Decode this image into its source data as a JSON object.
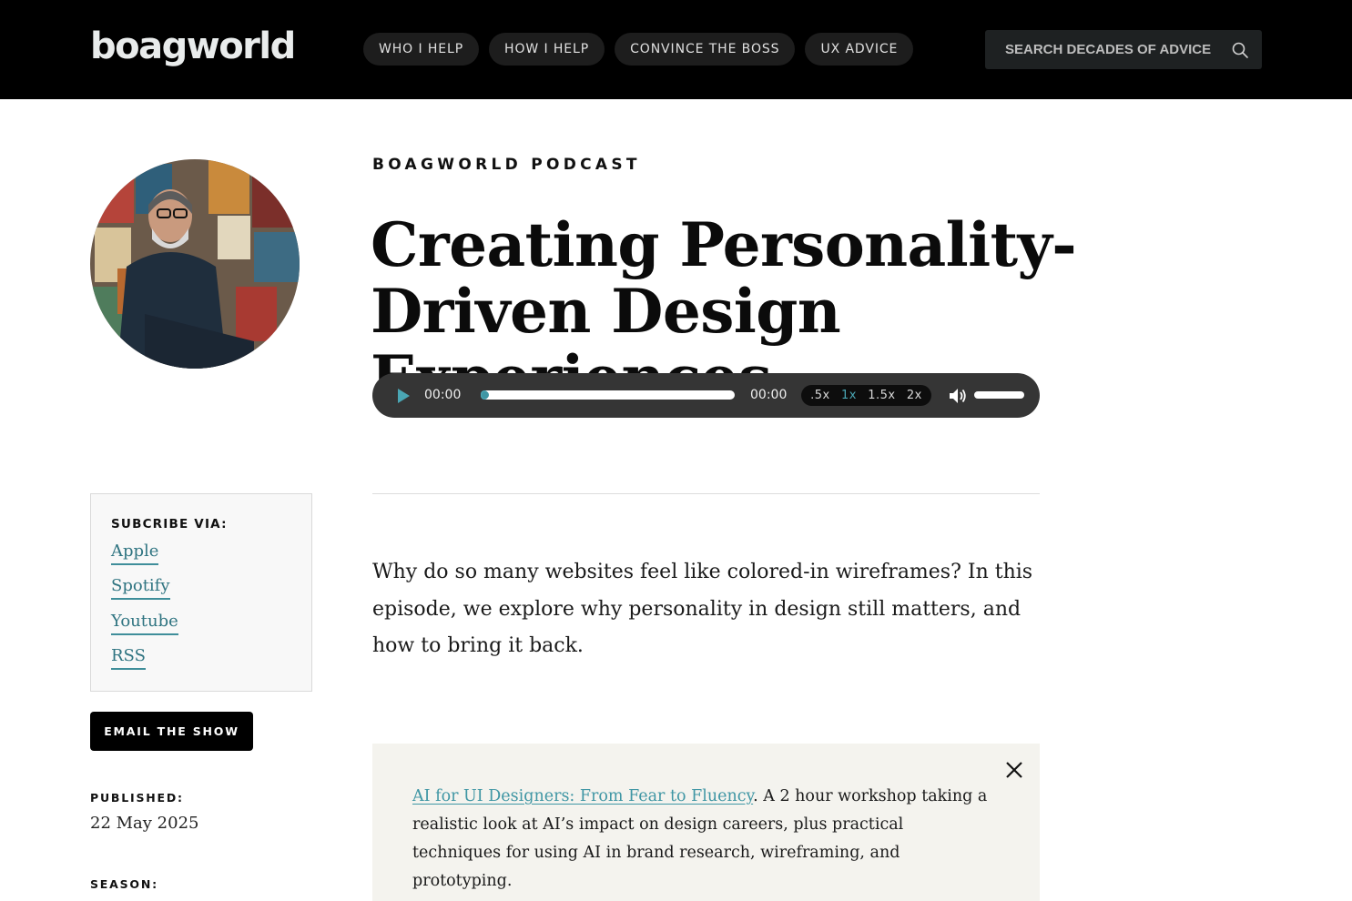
{
  "header": {
    "logo_text": "boagworld",
    "nav": [
      {
        "label": "WHO I HELP"
      },
      {
        "label": "HOW I HELP"
      },
      {
        "label": "CONVINCE THE BOSS"
      },
      {
        "label": "UX ADVICE"
      }
    ],
    "search": {
      "placeholder": "SEARCH DECADES OF ADVICE",
      "icon": "search-icon"
    }
  },
  "episode": {
    "kicker": "BOAGWORLD PODCAST",
    "title": "Creating Personality-Driven Design Experiences",
    "intro": "Why do so many websites feel like colored-in wireframes? In this episode, we explore why personality in design still matters, and how to bring it back."
  },
  "player": {
    "current_time": "00:00",
    "duration": "00:00",
    "progress": 0,
    "speeds": [
      ".5x",
      "1x",
      "1.5x",
      "2x"
    ],
    "active_speed": "1x",
    "volume": 1.0,
    "accent": "#4aa6b4"
  },
  "promo": {
    "link_text": "AI for UI Designers: From Fear to Fluency",
    "body": ". A 2 hour workshop taking a realistic look at AI’s impact on design careers, plus practical techniques for using AI in brand research, wireframing, and prototyping.",
    "background": "#f4f3ee"
  },
  "sidebar": {
    "subscribe_heading": "SUBCRIBE VIA:",
    "links": [
      {
        "label": "Apple"
      },
      {
        "label": "Spotify"
      },
      {
        "label": "Youtube"
      },
      {
        "label": "RSS"
      }
    ],
    "email_button": "EMAIL THE SHOW",
    "published_label": "PUBLISHED:",
    "published_value": "22 May 2025",
    "season_label": "SEASON:"
  }
}
